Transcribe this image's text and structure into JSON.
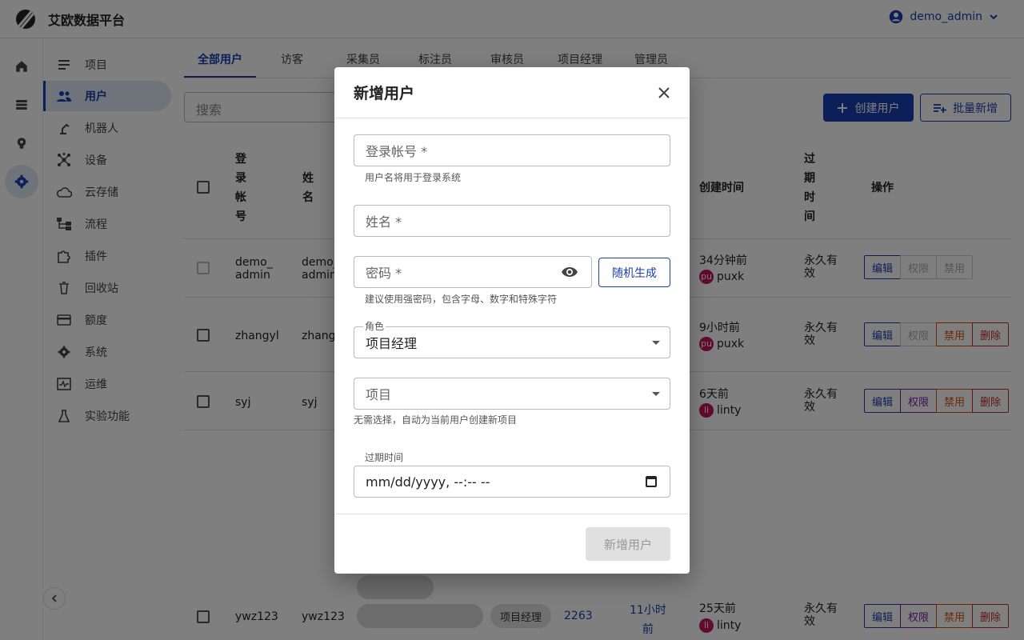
{
  "app": {
    "title": "艾欧数据平台",
    "user": "demo_admin"
  },
  "rail": [
    "home-icon",
    "storage-icon",
    "brain-icon",
    "settings-icon"
  ],
  "sidebar": {
    "items": [
      {
        "label": "项目",
        "icon": "list-icon"
      },
      {
        "label": "用户",
        "icon": "people-icon",
        "active": true
      },
      {
        "label": "机器人",
        "icon": "robot-arm-icon"
      },
      {
        "label": "设备",
        "icon": "hub-icon"
      },
      {
        "label": "云存储",
        "icon": "cloud-icon"
      },
      {
        "label": "流程",
        "icon": "flow-icon"
      },
      {
        "label": "插件",
        "icon": "puzzle-icon"
      },
      {
        "label": "回收站",
        "icon": "trash-icon"
      },
      {
        "label": "额度",
        "icon": "card-icon"
      },
      {
        "label": "系统",
        "icon": "gear-icon"
      },
      {
        "label": "运维",
        "icon": "monitor-icon"
      },
      {
        "label": "实验功能",
        "icon": "flask-icon"
      }
    ]
  },
  "tabs": [
    "全部用户",
    "访客",
    "采集员",
    "标注员",
    "审核员",
    "项目经理",
    "管理员"
  ],
  "toolbar": {
    "search_placeholder": "搜索",
    "create": "创建用户",
    "batch": "批量新增"
  },
  "table": {
    "headers": {
      "account": "登\n录\n帐\n号",
      "name": "姓\n名",
      "created": "创建时间",
      "expire": "过\n期\n时\n间",
      "ops": "操作"
    },
    "rows": [
      {
        "account": "demo_\nadmin",
        "name": "demo_\nadmin",
        "created": "34分钟前",
        "creator_abbr": "pu",
        "creator": "puxk",
        "expire": "永久有\n效",
        "ops": [
          "编辑",
          "权限",
          "禁用"
        ]
      },
      {
        "account": "zhangyl",
        "name": "zhangy",
        "created": "9小时前",
        "creator_abbr": "pu",
        "creator": "puxk",
        "expire": "永久有\n效",
        "ops": [
          "编辑",
          "权限",
          "禁用",
          "删除"
        ]
      },
      {
        "account": "syj",
        "name": "syj",
        "created": "6天前",
        "creator_abbr": "li",
        "creator": "linty",
        "expire": "永久有\n效",
        "ops": [
          "编辑",
          "权限",
          "禁用",
          "删除"
        ]
      },
      {
        "account": "ywz123",
        "name": "ywz123",
        "role": "项目经理",
        "count": "2263",
        "updated": "11小时\n前",
        "created": "25天前",
        "creator_abbr": "li",
        "creator": "linty",
        "expire": "永久有\n效",
        "ops": [
          "编辑",
          "权限",
          "禁用",
          "删除"
        ]
      }
    ]
  },
  "dialog": {
    "title": "新增用户",
    "account_label": "登录帐号 *",
    "account_helper": "用户名将用于登录系统",
    "name_label": "姓名 *",
    "password_label": "密码 *",
    "random_button": "随机生成",
    "password_helper": "建议使用强密码，包含字母、数字和特殊字符",
    "role_label": "角色",
    "role_value": "项目经理",
    "project_label": "项目",
    "project_helper": "无需选择，自动为当前用户创建新项目",
    "expire_label": "过期时间",
    "expire_value": "mm/dd/yyyy, --:-- --",
    "submit": "新增用户"
  }
}
